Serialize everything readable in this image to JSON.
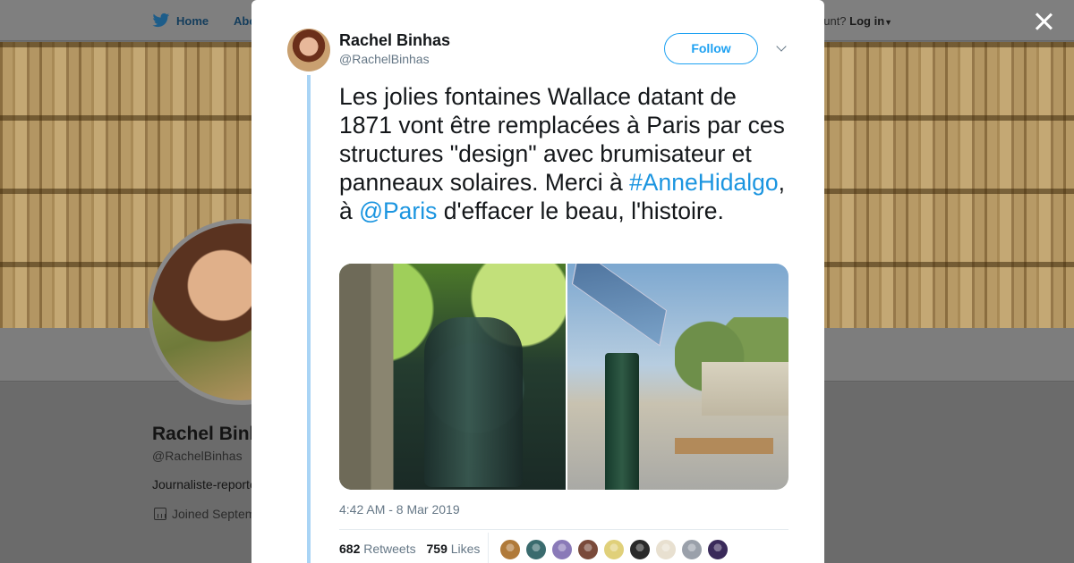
{
  "background_page": {
    "nav": {
      "home": "Home",
      "about": "Abo",
      "account_prompt": "ccount?",
      "login": "Log in"
    },
    "profile": {
      "name": "Rachel Binh",
      "handle": "@RachelBinhas",
      "bio": "Journaliste-reporte",
      "joined": "Joined Septem"
    }
  },
  "tweet": {
    "author_name": "Rachel Binhas",
    "author_handle": "@RachelBinhas",
    "follow_label": "Follow",
    "text_before": "Les jolies fontaines Wallace datant de 1871 vont être remplacées à Paris par ces structures \"design\" avec brumisateur et panneaux solaires. Merci à ",
    "hashtag": "#AnneHidalgo",
    "text_middle": ", à ",
    "mention": "@Paris",
    "text_after": " d'effacer le beau, l'histoire.",
    "timestamp": "4:42 AM - 8 Mar 2019",
    "retweets_count": "682",
    "retweets_label": "Retweets",
    "likes_count": "759",
    "likes_label": "Likes",
    "liker_colors": [
      "#b07a3a",
      "#3a6b6e",
      "#8a7ab8",
      "#7a4a3a",
      "#e0d07a",
      "#2a2a2a",
      "#e8e0d0",
      "#9aa0aa",
      "#3a2a5a"
    ]
  },
  "colors": {
    "accent": "#1da1f2",
    "link": "#1b95e0",
    "thread_line": "#a9d4f5"
  }
}
